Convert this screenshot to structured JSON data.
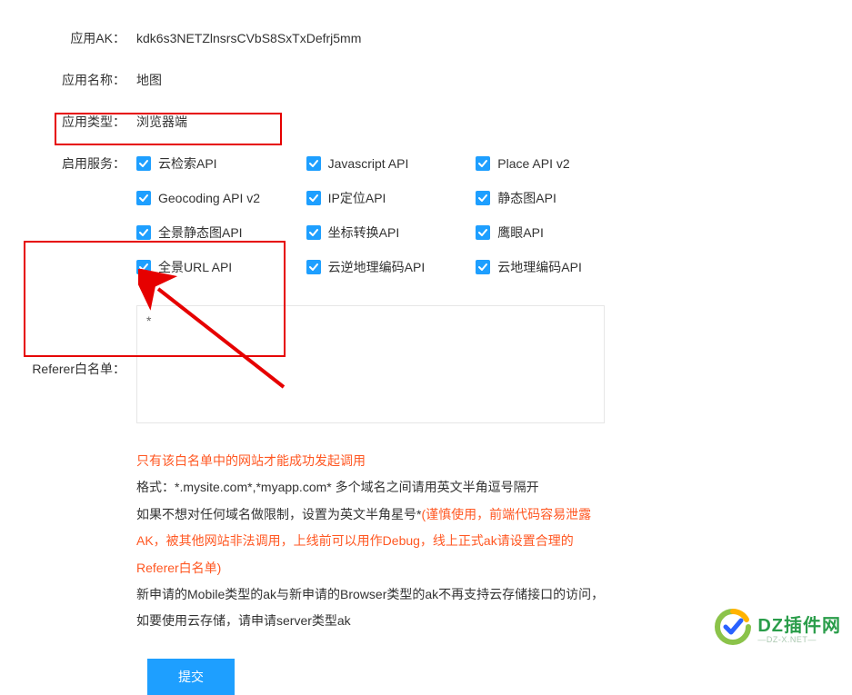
{
  "labels": {
    "ak": "应用AK：",
    "name": "应用名称：",
    "type": "应用类型：",
    "services": "启用服务：",
    "whitelist": "Referer白名单："
  },
  "values": {
    "ak": "kdk6s3NETZlnsrsCVbS8SxTxDefrj5mm",
    "name": "地图",
    "type": "浏览器端",
    "whitelist": "*"
  },
  "services": [
    {
      "label": "云检索API"
    },
    {
      "label": "Javascript API"
    },
    {
      "label": "Place API v2"
    },
    {
      "label": "Geocoding API v2"
    },
    {
      "label": "IP定位API"
    },
    {
      "label": "静态图API"
    },
    {
      "label": "全景静态图API"
    },
    {
      "label": "坐标转换API"
    },
    {
      "label": "鹰眼API"
    },
    {
      "label": "全景URL API"
    },
    {
      "label": "云逆地理编码API"
    },
    {
      "label": "云地理编码API"
    }
  ],
  "notes": {
    "n1": "只有该白名单中的网站才能成功发起调用",
    "n2": "格式：*.mysite.com*,*myapp.com* 多个域名之间请用英文半角逗号隔开",
    "n3a": "如果不想对任何域名做限制，设置为英文半角星号*",
    "n3b": "(谨慎使用，前端代码容易泄露AK，被其他网站非法调用，上线前可以用作Debug，线上正式ak请设置合理的Referer白名单)",
    "n4": "新申请的Mobile类型的ak与新申请的Browser类型的ak不再支持云存储接口的访问，如要使用云存储，请申请server类型ak"
  },
  "buttons": {
    "submit": "提交"
  },
  "watermark": {
    "main": "DZ插件网",
    "sub": "—DZ-X.NET—"
  }
}
